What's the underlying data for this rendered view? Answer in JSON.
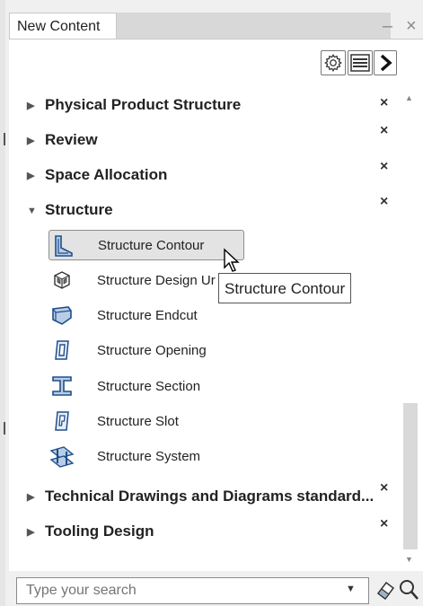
{
  "tab": {
    "label": "New Content"
  },
  "window": {
    "minimize_glyph": "–",
    "close_glyph": "×"
  },
  "toolbar": {
    "settings_icon": "gear-icon",
    "list_icon": "list-icon",
    "expand_icon": "chevron-right-icon"
  },
  "categories": [
    {
      "label": "Physical Product Structure",
      "expanded": false
    },
    {
      "label": "Review",
      "expanded": false
    },
    {
      "label": "Space Allocation",
      "expanded": false
    },
    {
      "label": "Structure",
      "expanded": true
    },
    {
      "label": "Technical Drawings and Diagrams standard...",
      "expanded": false
    },
    {
      "label": "Tooling Design",
      "expanded": false
    }
  ],
  "remove_glyph": "×",
  "structure_items": [
    {
      "label": "Structure Contour",
      "selected": true
    },
    {
      "label": "Structure Design Ur",
      "selected": false
    },
    {
      "label": "Structure Endcut",
      "selected": false
    },
    {
      "label": "Structure Opening",
      "selected": false
    },
    {
      "label": "Structure Section",
      "selected": false
    },
    {
      "label": "Structure Slot",
      "selected": false
    },
    {
      "label": "Structure System",
      "selected": false
    }
  ],
  "tooltip": {
    "text": "Structure Contour"
  },
  "search": {
    "placeholder": "Type your search"
  },
  "colors": {
    "icon_blue": "#1f4e8c",
    "selected_bg": "#e3e3e3"
  }
}
